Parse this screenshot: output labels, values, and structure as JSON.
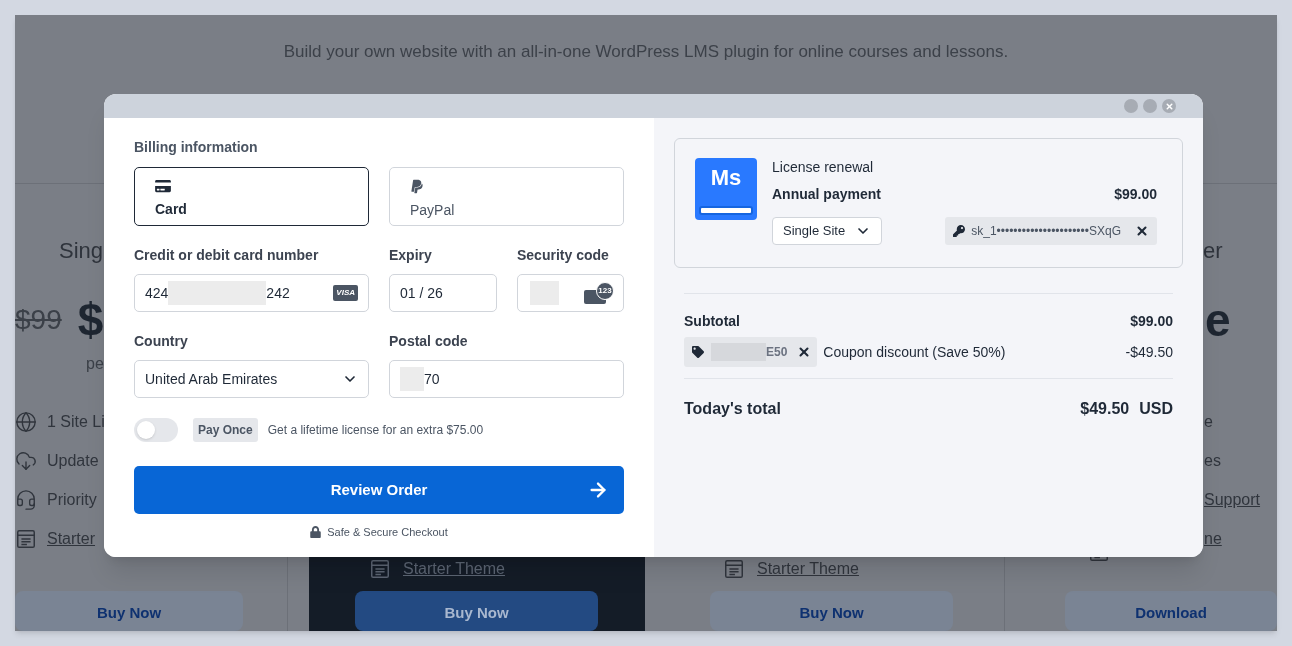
{
  "page": {
    "subtitle": "Build your own website with an all-in-one WordPress LMS plugin for online courses and lessons.",
    "plans": [
      {
        "highlighted": false,
        "title": "Sing",
        "old_price": "$99",
        "price": "$",
        "period": "pe",
        "features": [
          {
            "kind": "globe",
            "text": "1 Site Li",
            "link": false
          },
          {
            "kind": "cloud-download",
            "text": "Update",
            "link": false
          },
          {
            "kind": "headset",
            "text": "Priority",
            "link": false
          },
          {
            "kind": "template",
            "text": "Starter",
            "link": true
          }
        ],
        "button": "Buy Now"
      },
      {
        "highlighted": true,
        "features": [
          {
            "kind": "template",
            "text": "Starter Theme",
            "link": true
          }
        ],
        "button": "Buy Now"
      },
      {
        "highlighted": false,
        "features": [
          {
            "kind": "template",
            "text": "Starter Theme",
            "link": true
          }
        ],
        "button": "Buy Now"
      },
      {
        "highlighted": false,
        "title": "er",
        "price": "e",
        "features": [
          {
            "text": "e",
            "link": false
          },
          {
            "text": "es",
            "link": false
          },
          {
            "text": "Support",
            "link": true
          },
          {
            "kind": "template",
            "text": "ne",
            "link": true
          }
        ],
        "button": "Download"
      }
    ]
  },
  "modal": {
    "chrome_buttons": [
      {
        "kind": "dot"
      },
      {
        "kind": "dot"
      },
      {
        "kind": "close"
      }
    ],
    "billing": {
      "heading": "Billing information",
      "methods": [
        {
          "kind": "card",
          "label": "Card",
          "selected": true
        },
        {
          "kind": "paypal",
          "label": "PayPal",
          "selected": false
        }
      ],
      "card_number": {
        "label": "Credit or debit card number",
        "value_start": "424",
        "value_end": "242",
        "brand": "VISA"
      },
      "expiry": {
        "label": "Expiry",
        "value": "01 / 26"
      },
      "security_code": {
        "label": "Security code",
        "badge": "123"
      },
      "country": {
        "label": "Country",
        "value": "United Arab Emirates"
      },
      "postal_code": {
        "label": "Postal code",
        "value_end": "70"
      },
      "pay_once": {
        "on": false,
        "badge": "Pay Once",
        "text": "Get a lifetime license for an extra $75.00"
      },
      "submit": "Review Order",
      "secure_note": "Safe & Secure Checkout"
    },
    "summary": {
      "product": {
        "logo": "Ms",
        "type": "License renewal",
        "plan": "Annual payment",
        "price": "$99.00",
        "site_option": "Single Site",
        "license_key": "sk_1••••••••••••••••••••••SXqG"
      },
      "subtotal": {
        "label": "Subtotal",
        "value": "$99.00"
      },
      "coupon": {
        "code_end": "E50",
        "label": "Coupon discount (Save 50%)",
        "value": "-$49.50"
      },
      "total": {
        "label": "Today's total",
        "value": "$49.50",
        "currency": "USD"
      }
    }
  }
}
